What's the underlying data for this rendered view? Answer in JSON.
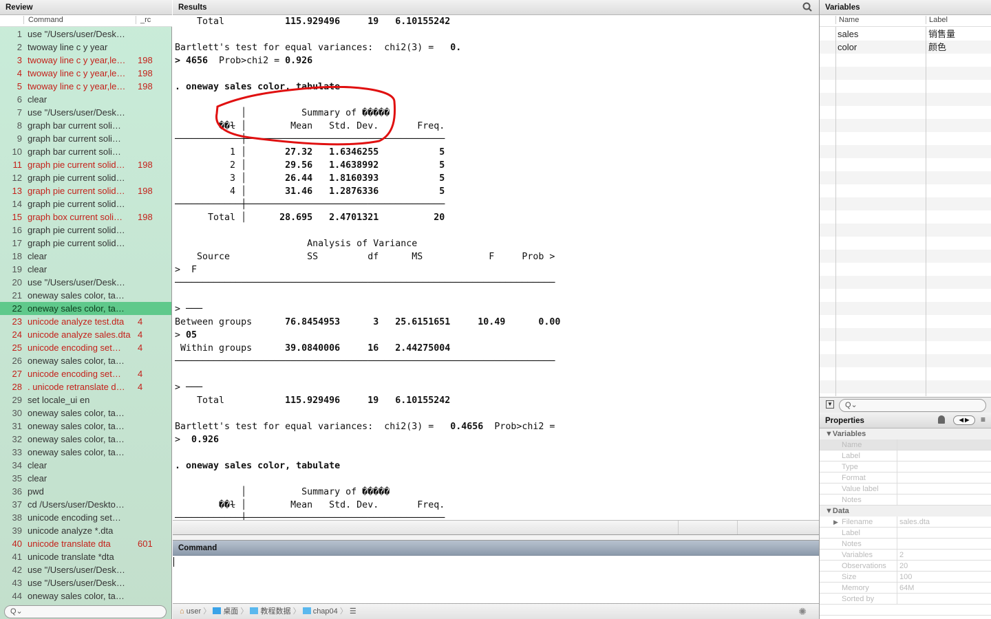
{
  "review": {
    "title": "Review",
    "col_command": "Command",
    "col_rc": "_rc",
    "search_placeholder": "Q⌄",
    "rows": [
      {
        "n": "1",
        "cmd": "use \"/Users/user/Desk…",
        "rc": ""
      },
      {
        "n": "2",
        "cmd": "twoway line c y year",
        "rc": ""
      },
      {
        "n": "3",
        "cmd": "twoway line c y year,le…",
        "rc": "198"
      },
      {
        "n": "4",
        "cmd": "twoway line c y year,le…",
        "rc": "198"
      },
      {
        "n": "5",
        "cmd": "twoway line c y year,le…",
        "rc": "198"
      },
      {
        "n": "6",
        "cmd": "clear",
        "rc": ""
      },
      {
        "n": "7",
        "cmd": "use \"/Users/user/Desk…",
        "rc": ""
      },
      {
        "n": "8",
        "cmd": "graph bar current soli…",
        "rc": ""
      },
      {
        "n": "9",
        "cmd": "graph bar current soli…",
        "rc": ""
      },
      {
        "n": "10",
        "cmd": "graph bar current soli…",
        "rc": ""
      },
      {
        "n": "11",
        "cmd": "graph pie current solid…",
        "rc": "198"
      },
      {
        "n": "12",
        "cmd": "graph pie current solid…",
        "rc": ""
      },
      {
        "n": "13",
        "cmd": "graph pie current solid…",
        "rc": "198"
      },
      {
        "n": "14",
        "cmd": "graph pie current solid…",
        "rc": ""
      },
      {
        "n": "15",
        "cmd": "graph box current soli…",
        "rc": "198"
      },
      {
        "n": "16",
        "cmd": "graph pie current solid…",
        "rc": ""
      },
      {
        "n": "17",
        "cmd": "graph pie current solid…",
        "rc": ""
      },
      {
        "n": "18",
        "cmd": "clear",
        "rc": ""
      },
      {
        "n": "19",
        "cmd": "clear",
        "rc": ""
      },
      {
        "n": "20",
        "cmd": "use \"/Users/user/Desk…",
        "rc": ""
      },
      {
        "n": "21",
        "cmd": "oneway sales color, ta…",
        "rc": ""
      },
      {
        "n": "22",
        "cmd": "oneway sales color, ta…",
        "rc": "",
        "selected": true
      },
      {
        "n": "23",
        "cmd": "unicode analyze test.dta",
        "rc": "4"
      },
      {
        "n": "24",
        "cmd": "unicode analyze sales.dta",
        "rc": "4"
      },
      {
        "n": "25",
        "cmd": "unicode encoding set…",
        "rc": "4"
      },
      {
        "n": "26",
        "cmd": "oneway sales color, ta…",
        "rc": ""
      },
      {
        "n": "27",
        "cmd": "unicode encoding set…",
        "rc": "4"
      },
      {
        "n": "28",
        "cmd": ". unicode retranslate d…",
        "rc": "4"
      },
      {
        "n": "29",
        "cmd": "set locale_ui en",
        "rc": ""
      },
      {
        "n": "30",
        "cmd": "oneway sales color, ta…",
        "rc": ""
      },
      {
        "n": "31",
        "cmd": "oneway sales color, ta…",
        "rc": ""
      },
      {
        "n": "32",
        "cmd": "oneway sales color, ta…",
        "rc": ""
      },
      {
        "n": "33",
        "cmd": "oneway sales color, ta…",
        "rc": ""
      },
      {
        "n": "34",
        "cmd": "clear",
        "rc": ""
      },
      {
        "n": "35",
        "cmd": "clear",
        "rc": ""
      },
      {
        "n": "36",
        "cmd": "pwd",
        "rc": ""
      },
      {
        "n": "37",
        "cmd": "cd /Users/user/Deskto…",
        "rc": ""
      },
      {
        "n": "38",
        "cmd": "unicode encoding set…",
        "rc": ""
      },
      {
        "n": "39",
        "cmd": "unicode analyze *.dta",
        "rc": ""
      },
      {
        "n": "40",
        "cmd": "unicode translate dta",
        "rc": "601"
      },
      {
        "n": "41",
        "cmd": "unicode translate *dta",
        "rc": ""
      },
      {
        "n": "42",
        "cmd": "use \"/Users/user/Desk…",
        "rc": ""
      },
      {
        "n": "43",
        "cmd": "use \"/Users/user/Desk…",
        "rc": ""
      },
      {
        "n": "44",
        "cmd": "oneway sales color, ta…",
        "rc": ""
      }
    ]
  },
  "results": {
    "title": "Results",
    "lines": [
      [
        [
          "    Total           ",
          0
        ],
        [
          "115.929496     19   6.10155242",
          1
        ]
      ],
      [],
      [
        [
          "Bartlett's test for equal variances:  chi2(3) =   ",
          0
        ],
        [
          "0.",
          1
        ]
      ],
      [
        [
          "> 4656",
          1
        ],
        [
          "  Prob>chi2 = ",
          0
        ],
        [
          "0.926",
          1
        ]
      ],
      [],
      [
        [
          ". oneway sales color, tabulate",
          1
        ]
      ],
      [],
      [
        [
          "            │          Summary of �����",
          0
        ]
      ],
      [
        [
          "        ��ɫ │        Mean   Std. Dev.       Freq.",
          0
        ]
      ],
      [
        [
          "────────────┼────────────────────────────────────",
          0
        ]
      ],
      [
        [
          "          1 │       ",
          0
        ],
        [
          "27.32   1.6346255           5",
          1
        ]
      ],
      [
        [
          "          2 │       ",
          0
        ],
        [
          "29.56   1.4638992           5",
          1
        ]
      ],
      [
        [
          "          3 │       ",
          0
        ],
        [
          "26.44   1.8160393           5",
          1
        ]
      ],
      [
        [
          "          4 │       ",
          0
        ],
        [
          "31.46   1.2876336           5",
          1
        ]
      ],
      [
        [
          "────────────┼────────────────────────────────────",
          0
        ]
      ],
      [
        [
          "      Total │      ",
          0
        ],
        [
          "28.695   2.4701321          20",
          1
        ]
      ],
      [],
      [
        [
          "                        Analysis of Variance",
          0
        ]
      ],
      [
        [
          "    Source              SS         df      MS            F     Prob >",
          0
        ]
      ],
      [
        [
          ">  F",
          0
        ]
      ],
      [
        [
          "─────────────────────────────────────────────────────────────────────",
          0
        ]
      ],
      [],
      [
        [
          "> ───",
          0
        ]
      ],
      [
        [
          "Between groups      ",
          0
        ],
        [
          "76.8454953      3   25.6151651     10.49      0.00",
          1
        ]
      ],
      [
        [
          "> ",
          0
        ],
        [
          "05",
          1
        ]
      ],
      [
        [
          " Within groups      ",
          0
        ],
        [
          "39.0840006     16   2.44275004",
          1
        ]
      ],
      [
        [
          "─────────────────────────────────────────────────────────────────────",
          0
        ]
      ],
      [],
      [
        [
          "> ───",
          0
        ]
      ],
      [
        [
          "    Total           ",
          0
        ],
        [
          "115.929496     19   6.10155242",
          1
        ]
      ],
      [],
      [
        [
          "Bartlett's test for equal variances:  chi2(3) =   ",
          0
        ],
        [
          "0.4656",
          1
        ],
        [
          "  Prob>chi2 =",
          0
        ]
      ],
      [
        [
          ">  ",
          0
        ],
        [
          "0.926",
          1
        ]
      ],
      [],
      [
        [
          ". oneway sales color, tabulate",
          1
        ]
      ],
      [],
      [
        [
          "            │          Summary of �����",
          0
        ]
      ],
      [
        [
          "        ��ɫ │        Mean   Std. Dev.       Freq.",
          0
        ]
      ],
      [
        [
          "────────────┼────────────────────────────────────",
          0
        ]
      ],
      [
        [
          "          1 │       ",
          0
        ],
        [
          "27.32   1.6346255           5",
          1
        ]
      ],
      [
        [
          "          2 │       ",
          0
        ],
        [
          "29.56   1.4638992           5",
          1
        ]
      ]
    ]
  },
  "command": {
    "title": "Command",
    "value": ""
  },
  "breadcrumb": [
    "user",
    "桌面",
    "教程数据",
    "chap04"
  ],
  "variables": {
    "title": "Variables",
    "col_name": "Name",
    "col_label": "Label",
    "search_placeholder": "Q⌄",
    "rows": [
      {
        "name": "sales",
        "label": "销售量"
      },
      {
        "name": "color",
        "label": "颜色"
      }
    ]
  },
  "properties": {
    "title": "Properties",
    "sections": [
      {
        "title": "▼Variables",
        "rows": [
          {
            "k": "Name",
            "v": ""
          },
          {
            "k": "Label",
            "v": ""
          },
          {
            "k": "Type",
            "v": ""
          },
          {
            "k": "Format",
            "v": ""
          },
          {
            "k": "Value label",
            "v": ""
          },
          {
            "k": "Notes",
            "v": ""
          }
        ]
      },
      {
        "title": "▼Data",
        "rows": [
          {
            "k": "Filename",
            "v": "sales.dta",
            "expand": true
          },
          {
            "k": "Label",
            "v": ""
          },
          {
            "k": "Notes",
            "v": ""
          },
          {
            "k": "Variables",
            "v": "2"
          },
          {
            "k": "Observations",
            "v": "20"
          },
          {
            "k": "Size",
            "v": "100"
          },
          {
            "k": "Memory",
            "v": "64M"
          },
          {
            "k": "Sorted by",
            "v": ""
          }
        ]
      }
    ]
  },
  "colors": {
    "error": "#c4211a",
    "selected": "#5fc98b",
    "annotation": "#e01010"
  }
}
